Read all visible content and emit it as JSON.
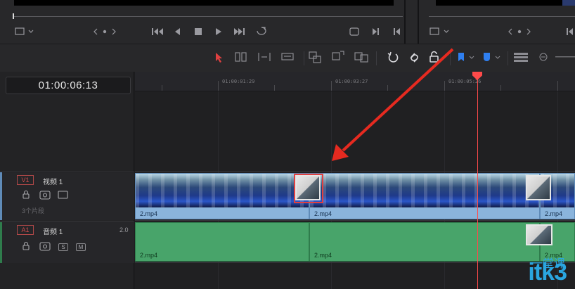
{
  "viewer": {
    "icons": [
      "timeline-view-icon",
      "chevron-down-icon",
      "prev-marker-icon",
      "dot-icon",
      "next-marker-icon",
      "jump-to-start-icon",
      "step-back-icon",
      "stop-icon",
      "play-icon",
      "jump-to-end-icon",
      "loop-icon",
      "match-frame-icon",
      "prev-edit-icon",
      "next-edit-icon"
    ]
  },
  "timecode": {
    "current": "01:00:06:13"
  },
  "ruler": {
    "labels": [
      "01:00:01:29",
      "01:00:03:27",
      "01:00:05:26"
    ]
  },
  "tracks": {
    "video": {
      "badge": "V1",
      "name": "视频 1",
      "clip_count": "3个片段"
    },
    "audio": {
      "badge": "A1",
      "name": "音频 1",
      "channels": "2.0",
      "solo": "S",
      "mute": "M"
    }
  },
  "clips": {
    "video": [
      {
        "label": "2.mp4"
      },
      {
        "label": "2.mp4"
      },
      {
        "label": "2.mp4"
      }
    ],
    "audio": [
      {
        "label": "2.mp4"
      },
      {
        "label": "2.mp4"
      },
      {
        "label": "2.mp4"
      }
    ]
  },
  "annotation": {
    "arrow_color": "#e62a20",
    "highlight_color": "#e04040"
  },
  "watermark": {
    "text": "itk3",
    "cn": "一堂课"
  },
  "colors": {
    "playhead": "#ff4a4a",
    "video_clip": "#8ab4dc",
    "audio_clip": "#48a46a",
    "flag_blue": "#2f7ff0"
  }
}
